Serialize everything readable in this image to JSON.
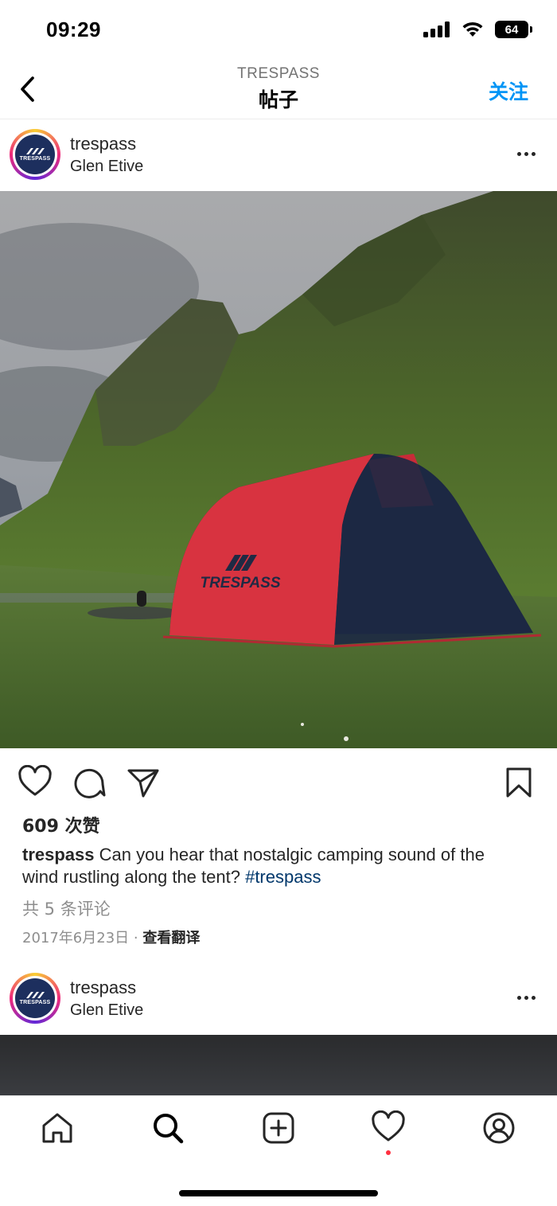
{
  "status_bar": {
    "time": "09:29",
    "battery": "64"
  },
  "header": {
    "subtitle": "TRESPASS",
    "title": "帖子",
    "follow_label": "关注"
  },
  "post": {
    "username": "trespass",
    "location": "Glen Etive",
    "avatar_text": "TRESPASS",
    "tent_brand": "TRESPASS",
    "likes": "609 次赞",
    "caption_user": "trespass",
    "caption_text": " Can you hear that nostalgic camping sound of the wind rustling along the tent? ",
    "caption_tag": "#trespass",
    "comments": "共 5 条评论",
    "date": "2017年6月23日",
    "separator": " · ",
    "translate_label": "查看翻译"
  },
  "next_post": {
    "username": "trespass",
    "location": "Glen Etive",
    "avatar_text": "TRESPASS"
  },
  "tabbar": {
    "items": [
      "home-icon",
      "search-icon",
      "create-icon",
      "heart-icon",
      "profile-icon"
    ]
  },
  "colors": {
    "accent": "#0095f6",
    "hashtag": "#00376b",
    "notification": "#ff3040",
    "brand_navy": "#1d2f5e"
  }
}
